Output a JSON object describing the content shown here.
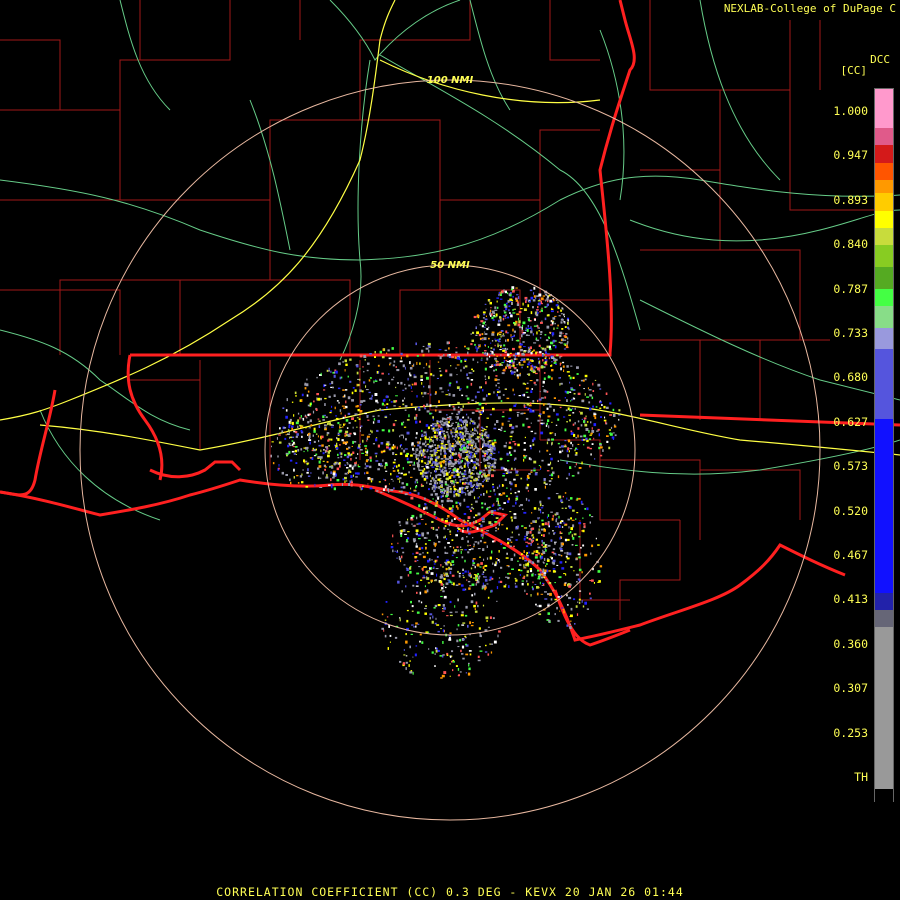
{
  "header": {
    "credit": "NEXLAB-College of DuPage C",
    "product_code": "DCC",
    "unit": "[CC]"
  },
  "range_rings": [
    {
      "label": "100 NMI"
    },
    {
      "label": "50 NMI"
    }
  ],
  "colorbar": {
    "ticks": [
      "1.000",
      "0.947",
      "0.893",
      "0.840",
      "0.787",
      "0.733",
      "0.680",
      "0.627",
      "0.573",
      "0.520",
      "0.467",
      "0.413",
      "0.360",
      "0.307",
      "0.253",
      "TH"
    ],
    "segments": [
      {
        "color": "#ff99cc",
        "value": 1.0
      },
      {
        "color": "#e05a8a",
        "value": 0.975
      },
      {
        "color": "#d41a1a",
        "value": 0.955
      },
      {
        "color": "#ff5500",
        "value": 0.935
      },
      {
        "color": "#ff9900",
        "value": 0.915
      },
      {
        "color": "#ffcc00",
        "value": 0.9
      },
      {
        "color": "#ffff00",
        "value": 0.88
      },
      {
        "color": "#c8dc3c",
        "value": 0.86
      },
      {
        "color": "#88cc22",
        "value": 0.84
      },
      {
        "color": "#55aa22",
        "value": 0.815
      },
      {
        "color": "#44ff44",
        "value": 0.79
      },
      {
        "color": "#88dd88",
        "value": 0.77
      },
      {
        "color": "#9999dd",
        "value": 0.745
      },
      {
        "color": "#5555dd",
        "value": 0.72
      },
      {
        "color": "#1111ff",
        "value": 0.64
      },
      {
        "color": "#2222aa",
        "value": 0.44
      },
      {
        "color": "#666677",
        "value": 0.42
      },
      {
        "color": "#999999",
        "value": 0.4
      },
      {
        "color": "#000000",
        "value": 0.0
      }
    ]
  },
  "footer": {
    "text": "CORRELATION COEFFICIENT (CC) 0.3 DEG - KEVX 20 JAN 26 01:44"
  }
}
